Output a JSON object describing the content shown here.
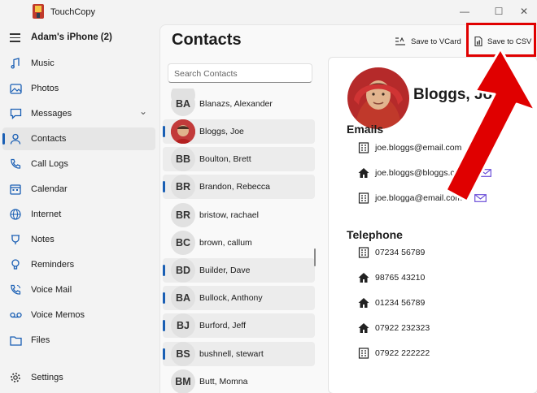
{
  "app": {
    "title": "TouchCopy"
  },
  "window_controls": {
    "minimize": "—",
    "maximize": "☐",
    "close": "✕"
  },
  "sidebar": {
    "device_name": "Adam's iPhone (2)",
    "items": [
      {
        "label": "Music",
        "icon": "music-icon"
      },
      {
        "label": "Photos",
        "icon": "photos-icon"
      },
      {
        "label": "Messages",
        "icon": "messages-icon",
        "expandable": true
      },
      {
        "label": "Contacts",
        "icon": "contacts-icon",
        "active": true
      },
      {
        "label": "Call Logs",
        "icon": "phone-icon"
      },
      {
        "label": "Calendar",
        "icon": "calendar-icon"
      },
      {
        "label": "Internet",
        "icon": "globe-icon"
      },
      {
        "label": "Notes",
        "icon": "notes-icon"
      },
      {
        "label": "Reminders",
        "icon": "reminders-icon"
      },
      {
        "label": "Voice Mail",
        "icon": "voicemail-icon"
      },
      {
        "label": "Voice Memos",
        "icon": "voicememo-icon"
      },
      {
        "label": "Files",
        "icon": "folder-icon"
      }
    ],
    "settings_label": "Settings",
    "chevron": "⌄"
  },
  "main": {
    "title": "Contacts",
    "toolbar": {
      "vcard_label": "Save to VCard",
      "csv_label": "Save to CSV"
    },
    "search_placeholder": "Search Contacts"
  },
  "contacts": [
    {
      "initials": "BA",
      "name": "Blanazs, Alexander",
      "marked": false
    },
    {
      "initials": "",
      "name": "Bloggs, Joe",
      "marked": true,
      "photo": true
    },
    {
      "initials": "BB",
      "name": "Boulton, Brett",
      "marked": false
    },
    {
      "initials": "BR",
      "name": "Brandon, Rebecca",
      "marked": true
    },
    {
      "initials": "BR",
      "name": "bristow, rachael",
      "marked": false
    },
    {
      "initials": "BC",
      "name": "brown, callum",
      "marked": false
    },
    {
      "initials": "BD",
      "name": "Builder, Dave",
      "marked": true
    },
    {
      "initials": "BA",
      "name": "Bullock, Anthony",
      "marked": true
    },
    {
      "initials": "BJ",
      "name": "Burford, Jeff",
      "marked": true
    },
    {
      "initials": "BS",
      "name": "bushnell, stewart",
      "marked": true
    },
    {
      "initials": "BM",
      "name": "Butt, Momna",
      "marked": false
    }
  ],
  "detail": {
    "name": "Bloggs, Joe",
    "emails_title": "Emails",
    "emails": [
      {
        "value": "joe.bloggs@email.com",
        "type": "work"
      },
      {
        "value": "joe.bloggs@bloggs.com",
        "type": "home"
      },
      {
        "value": "joe.blogga@email.com",
        "type": "work"
      }
    ],
    "telephone_title": "Telephone",
    "phones": [
      {
        "value": "07234 56789",
        "type": "work"
      },
      {
        "value": "98765 43210",
        "type": "home"
      },
      {
        "value": "01234 56789",
        "type": "home"
      },
      {
        "value": "07922 232323",
        "type": "home"
      },
      {
        "value": "07922 222222",
        "type": "work"
      }
    ]
  },
  "colors": {
    "accent": "#1a5fb4",
    "highlight": "#e00000",
    "mail_icon": "#6b4fd8"
  }
}
